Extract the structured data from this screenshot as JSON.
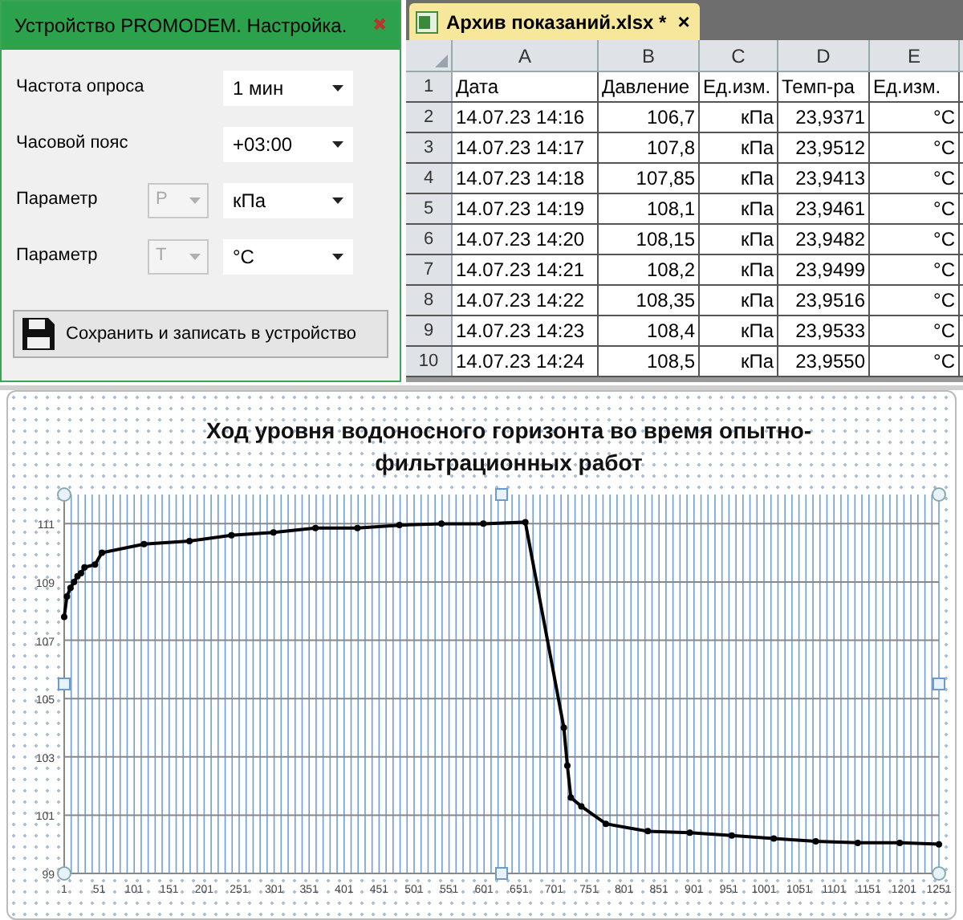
{
  "dialog": {
    "title": "Устройство PROMODEM. Настройка.",
    "close": "✖",
    "fields": [
      {
        "label": "Частота опроса",
        "value": "1 мин"
      },
      {
        "label": "Часовой пояс",
        "value": "+03:00"
      },
      {
        "label": "Параметр",
        "param": {
          "value": "P",
          "disabled": true
        },
        "value": "кПа"
      },
      {
        "label": "Параметр",
        "param": {
          "value": "T",
          "disabled": true
        },
        "value": "°C"
      }
    ],
    "save_button": "Сохранить и записать в устройство"
  },
  "spreadsheet": {
    "tab": {
      "label": "Архив показаний.xlsx *",
      "close": "×"
    },
    "columns": [
      "A",
      "B",
      "C",
      "D",
      "E"
    ],
    "rows": [
      {
        "number": "1",
        "cells": [
          "Дата",
          "Давление",
          "Ед.изм.",
          "Темп-ра",
          "Ед.изм."
        ]
      },
      {
        "number": "2",
        "cells": [
          "14.07.23 14:16",
          "106,7",
          "кПа",
          "23,9371",
          "°C"
        ]
      },
      {
        "number": "3",
        "cells": [
          "14.07.23 14:17",
          "107,8",
          "кПа",
          "23,9512",
          "°C"
        ]
      },
      {
        "number": "4",
        "cells": [
          "14.07.23 14:18",
          "107,85",
          "кПа",
          "23,9413",
          "°C"
        ]
      },
      {
        "number": "5",
        "cells": [
          "14.07.23 14:19",
          "108,1",
          "кПа",
          "23,9461",
          "°C"
        ]
      },
      {
        "number": "6",
        "cells": [
          "14.07.23 14:20",
          "108,15",
          "кПа",
          "23,9482",
          "°C"
        ]
      },
      {
        "number": "7",
        "cells": [
          "14.07.23 14:21",
          "108,2",
          "кПа",
          "23,9499",
          "°C"
        ]
      },
      {
        "number": "8",
        "cells": [
          "14.07.23 14:22",
          "108,35",
          "кПа",
          "23,9516",
          "°C"
        ]
      },
      {
        "number": "9",
        "cells": [
          "14.07.23 14:23",
          "108,4",
          "кПа",
          "23,9533",
          "°C"
        ]
      },
      {
        "number": "10",
        "cells": [
          "14.07.23 14:24",
          "108,5",
          "кПа",
          "23,9550",
          "°C"
        ]
      }
    ]
  },
  "chart": {
    "chart_data": {
      "type": "line",
      "title": "Ход уровня водоносного горизонта во время опытно-фильтрационных работ",
      "grid": true,
      "x": [
        1,
        5,
        10,
        15,
        20,
        25,
        30,
        45,
        55,
        115,
        180,
        240,
        300,
        360,
        420,
        480,
        540,
        600,
        660,
        715,
        720,
        725,
        740,
        775,
        835,
        895,
        955,
        1015,
        1075,
        1135,
        1195,
        1251
      ],
      "series": [
        {
          "color": "#000000",
          "marker": "circle",
          "values": [
            107.8,
            108.5,
            108.8,
            109.0,
            109.2,
            109.3,
            109.5,
            109.6,
            110.0,
            110.3,
            110.4,
            110.6,
            110.7,
            110.85,
            110.85,
            110.95,
            111.0,
            111.0,
            111.05,
            104.0,
            102.7,
            101.6,
            101.3,
            100.7,
            100.45,
            100.4,
            100.3,
            100.2,
            100.1,
            100.05,
            100.05,
            100.0
          ]
        }
      ],
      "xlim": [
        1,
        1251
      ],
      "ylim": [
        99,
        112
      ],
      "xticks": [
        1,
        51,
        101,
        151,
        201,
        251,
        301,
        351,
        401,
        451,
        501,
        551,
        601,
        651,
        701,
        751,
        801,
        851,
        901,
        951,
        1001,
        1051,
        1101,
        1151,
        1201,
        1251
      ],
      "yticks": [
        99,
        101,
        103,
        105,
        107,
        109,
        111
      ]
    }
  }
}
